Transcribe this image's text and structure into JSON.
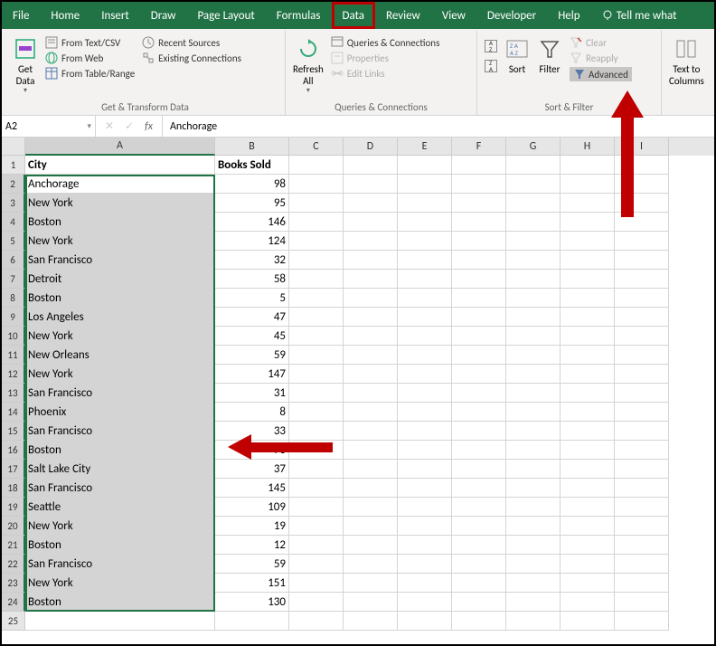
{
  "tabs": [
    "File",
    "Home",
    "Insert",
    "Draw",
    "Page Layout",
    "Formulas",
    "Data",
    "Review",
    "View",
    "Developer",
    "Help",
    "Tell me what"
  ],
  "active_tab": "Data",
  "ribbon": {
    "get_transform": {
      "get_data": "Get\nData",
      "from_text_csv": "From Text/CSV",
      "from_web": "From Web",
      "from_table_range": "From Table/Range",
      "recent_sources": "Recent Sources",
      "existing_connections": "Existing Connections",
      "label": "Get & Transform Data"
    },
    "queries": {
      "refresh_all": "Refresh\nAll",
      "queries_connections": "Queries & Connections",
      "properties": "Properties",
      "edit_links": "Edit Links",
      "label": "Queries & Connections"
    },
    "sort_filter": {
      "sort": "Sort",
      "filter": "Filter",
      "clear": "Clear",
      "reapply": "Reapply",
      "advanced": "Advanced",
      "label": "Sort & Filter"
    },
    "text_to_columns": "Text to\nColumns"
  },
  "name_box": "A2",
  "formula_value": "Anchorage",
  "columns": [
    "A",
    "B",
    "C",
    "D",
    "E",
    "F",
    "G",
    "H",
    "I"
  ],
  "headers": {
    "col_a": "City",
    "col_b": "Books Sold"
  },
  "rows": [
    {
      "n": 2,
      "city": "Anchorage",
      "books": 98
    },
    {
      "n": 3,
      "city": "New York",
      "books": 95
    },
    {
      "n": 4,
      "city": "Boston",
      "books": 146
    },
    {
      "n": 5,
      "city": "New York",
      "books": 124
    },
    {
      "n": 6,
      "city": "San Francisco",
      "books": 32
    },
    {
      "n": 7,
      "city": "Detroit",
      "books": 58
    },
    {
      "n": 8,
      "city": "Boston",
      "books": 5
    },
    {
      "n": 9,
      "city": "Los Angeles",
      "books": 47
    },
    {
      "n": 10,
      "city": "New York",
      "books": 45
    },
    {
      "n": 11,
      "city": "New Orleans",
      "books": 59
    },
    {
      "n": 12,
      "city": "New York",
      "books": 147
    },
    {
      "n": 13,
      "city": "San Francisco",
      "books": 31
    },
    {
      "n": 14,
      "city": "Phoenix",
      "books": 8
    },
    {
      "n": 15,
      "city": "San Francisco",
      "books": 33
    },
    {
      "n": 16,
      "city": "Boston",
      "books": 73
    },
    {
      "n": 17,
      "city": "Salt Lake City",
      "books": 37
    },
    {
      "n": 18,
      "city": "San Francisco",
      "books": 145
    },
    {
      "n": 19,
      "city": "Seattle",
      "books": 109
    },
    {
      "n": 20,
      "city": "New York",
      "books": 19
    },
    {
      "n": 21,
      "city": "Boston",
      "books": 12
    },
    {
      "n": 22,
      "city": "San Francisco",
      "books": 59
    },
    {
      "n": 23,
      "city": "New York",
      "books": 151
    },
    {
      "n": 24,
      "city": "Boston",
      "books": 130
    }
  ],
  "empty_row": 25
}
